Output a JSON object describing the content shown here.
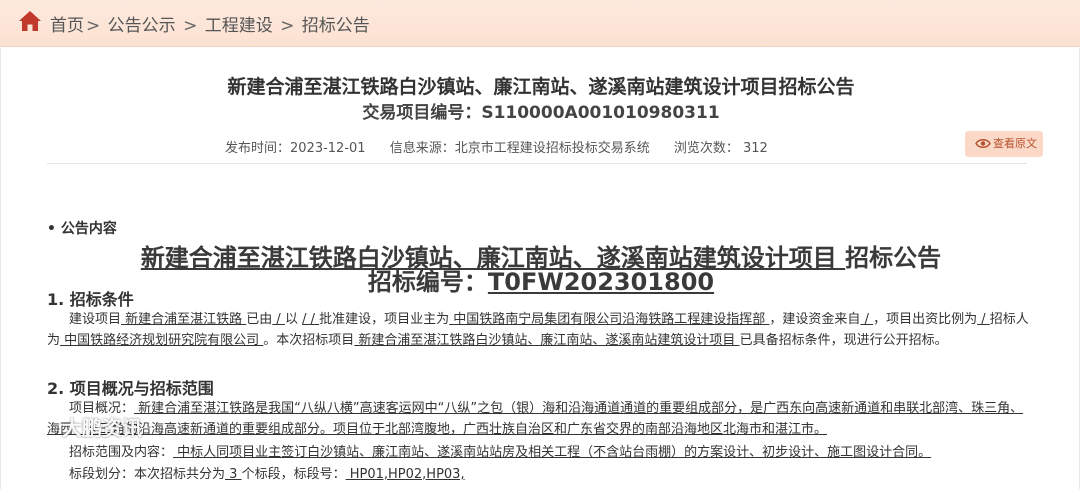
{
  "breadcrumb": {
    "items": [
      "首页",
      "公告公示",
      "工程建设",
      "招标公告"
    ],
    "separator": ">"
  },
  "header": {
    "title": "新建合浦至湛江铁路白沙镇站、廉江南站、遂溪南站建筑设计项目招标公告",
    "code": "交易项目编号：S110000A001010980311"
  },
  "meta": {
    "publish": "发布时间：2023-12-01",
    "source": "信息来源：北京市工程建设招标投标交易系统",
    "views": "浏览次数：  312"
  },
  "view_original_label": "查看原文",
  "content": {
    "section_label": "• 公告内容",
    "doc_title_pre": "    新建合浦至湛江铁路白沙镇站、廉江南站、遂溪南站建筑设计项目  ",
    "doc_title_post": "招标公告",
    "doc_code_label": "招标编号：",
    "doc_code_value": "T0FW202301800",
    "s1_heading": "1. 招标条件",
    "s1_t1": "建设项目",
    "s1_u1": "  新建合浦至湛江铁路  ",
    "s1_t2": "已由",
    "s1_u2": "  /  ",
    "s1_t3": "以",
    "s1_u3": "  /  ",
    "s1_u4": "  /  ",
    "s1_t4": "批准建设，项目业主为",
    "s1_u5": "  中国铁路南宁局集团有限公司沿海铁路工程建设指挥部  ",
    "s1_t5": "，建设资金来自",
    "s1_u6": "  /  ",
    "s1_t6": "，项目出资比例为",
    "s1_u7": "  /  ",
    "s1_t7": "招标人为",
    "s1_u8": "  中国铁路经济规划研究院有限公司  ",
    "s1_t8": "。本次招标项目",
    "s1_u9": "  新建合浦至湛江铁路白沙镇站、廉江南站、遂溪南站建筑设计项目  ",
    "s1_t9": "已具备招标条件，现进行公开招标。",
    "s2_heading": "2. 项目概况与招标范围",
    "s2_overview_label": "项目概况：",
    "s2_overview": "  新建合浦至湛江铁路是我国“八纵八横”高速客运网中“八纵”之包（银）海和沿海通道通道的重要组成部分，是广西东向高速新通道和串联北部湾、珠三角、海西、长三角的沿海高速新通道的重要组成部分。项目位于北部湾腹地，广西壮族自治区和广东省交界的南部沿海地区北海市和湛江市。  ",
    "s2_scope_label": "招标范围及内容：",
    "s2_scope": "  中标人同项目业主签订白沙镇站、廉江南站、遂溪南站站房及相关工程（不含站台雨棚）的方案设计、初步设计、施工图设计合同。  ",
    "s2_lots_t1": "标段划分：本次招标共分为",
    "s2_lots_u1": "  3  ",
    "s2_lots_t2": "个标段，标段号：",
    "s2_lots_u2": "  HP01,HP02,HP03,  "
  },
  "watermark": "大鹏资讯",
  "colors": {
    "accent": "#c0392b",
    "topbar": "#fbe4d6",
    "button_bg": "#fbd9c8",
    "button_text": "#b8512e"
  },
  "icons": {
    "home": "home-icon",
    "view": "eye-icon",
    "watermark": "weibo-icon"
  }
}
